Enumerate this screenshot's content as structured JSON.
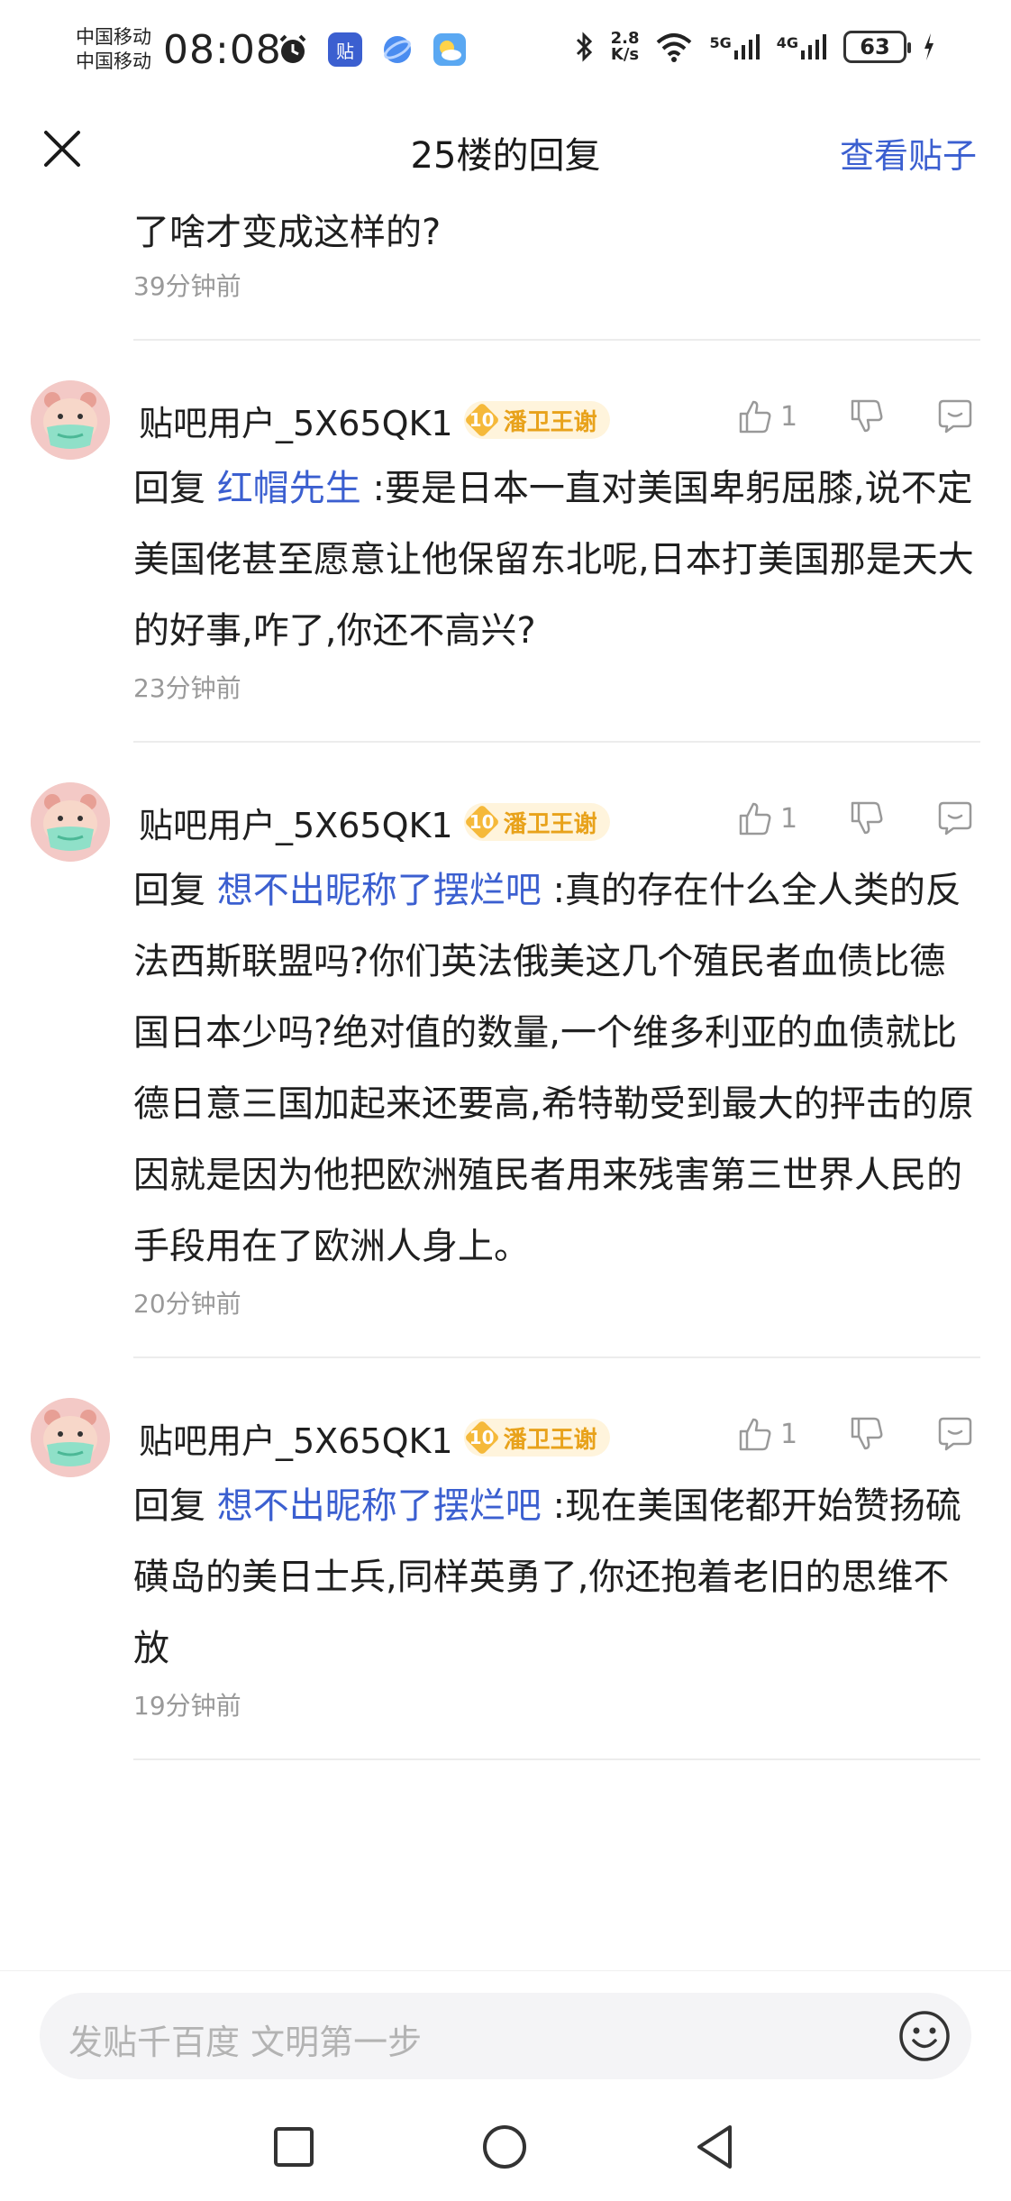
{
  "status_bar": {
    "carrier_1": "中国移动",
    "carrier_2": "中国移动",
    "time": "08:08",
    "net_speed_value": "2.8",
    "net_speed_unit": "K/s",
    "net_5g": "5G",
    "net_4g": "4G",
    "battery": "63"
  },
  "header": {
    "title": "25楼的回复",
    "view_post": "查看贴子"
  },
  "top_snippet": {
    "text": "了啥才变成这样的?",
    "time_ago": "39分钟前"
  },
  "replies": [
    {
      "username": "贴吧用户_5X65QK1",
      "level": "10",
      "level_title": "潘卫王谢",
      "likes": "1",
      "prefix": "回复",
      "mention": "红帽先生",
      "text": ":要是日本一直对美国卑躬屈膝,说不定美国佬甚至愿意让他保留东北呢,日本打美国那是天大的好事,咋了,你还不高兴?",
      "time_ago": "23分钟前"
    },
    {
      "username": "贴吧用户_5X65QK1",
      "level": "10",
      "level_title": "潘卫王谢",
      "likes": "1",
      "prefix": "回复",
      "mention": "想不出昵称了摆烂吧",
      "text": ":真的存在什么全人类的反法西斯联盟吗?你们英法俄美这几个殖民者血债比德国日本少吗?绝对值的数量,一个维多利亚的血债就比德日意三国加起来还要高,希特勒受到最大的抨击的原因就是因为他把欧洲殖民者用来残害第三世界人民的手段用在了欧洲人身上。",
      "time_ago": "20分钟前"
    },
    {
      "username": "贴吧用户_5X65QK1",
      "level": "10",
      "level_title": "潘卫王谢",
      "likes": "1",
      "prefix": "回复",
      "mention": "想不出昵称了摆烂吧",
      "text": ":现在美国佬都开始赞扬硫磺岛的美日士兵,同样英勇了,你还抱着老旧的思维不放",
      "time_ago": "19分钟前"
    }
  ],
  "input": {
    "placeholder": "发贴千百度 文明第一步"
  },
  "colors": {
    "accent": "#3b5fd0",
    "muted": "#999999",
    "badge": "#e8a21b"
  }
}
